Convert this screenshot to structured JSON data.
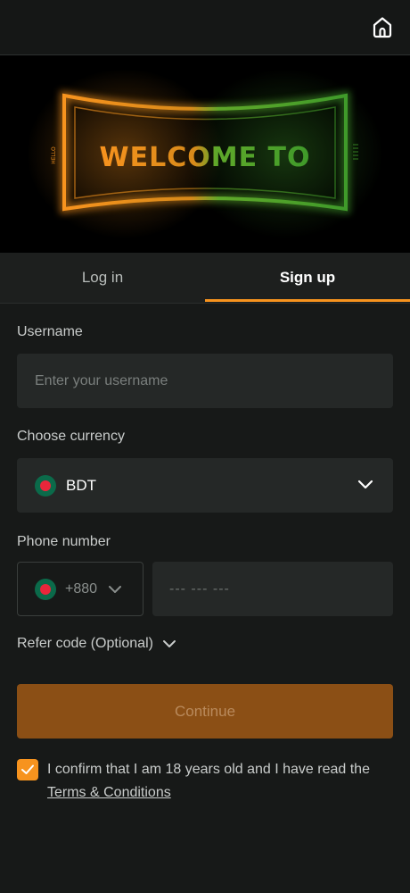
{
  "header": {
    "home_icon": "home-icon"
  },
  "banner": {
    "headline": "WELCOME TO",
    "side_text": "HELLO",
    "colors": {
      "orange": "#f7931e",
      "green": "#3f9a2a"
    }
  },
  "tabs": [
    {
      "label": "Log in",
      "active": false
    },
    {
      "label": "Sign up",
      "active": true
    }
  ],
  "form": {
    "username": {
      "label": "Username",
      "placeholder": "Enter your username",
      "value": ""
    },
    "currency": {
      "label": "Choose currency",
      "selected": "BDT",
      "flag_icon": "bangladesh-flag-icon"
    },
    "phone": {
      "label": "Phone number",
      "country_code": "+880",
      "placeholder": "--- --- ---",
      "value": ""
    },
    "refer": {
      "label": "Refer code (Optional)"
    },
    "continue_label": "Continue",
    "confirm": {
      "checked": true,
      "text": "I confirm that I am 18 years old and I have read the",
      "link": "Terms & Conditions"
    }
  },
  "colors": {
    "accent": "#f7931e",
    "background": "#171918",
    "field": "#252827",
    "button": "#8b4f15"
  }
}
